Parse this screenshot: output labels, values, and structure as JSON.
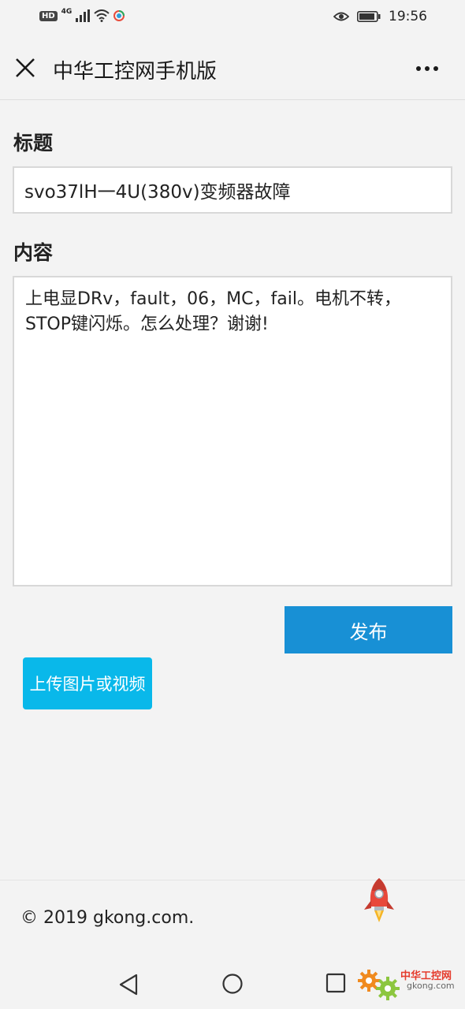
{
  "status_bar": {
    "hd": "HD",
    "network": "4G",
    "time": "19:56"
  },
  "header": {
    "title": "中华工控网手机版"
  },
  "form": {
    "title_label": "标题",
    "title_value": "svo37lH一4U(380v)变频器故障",
    "content_label": "内容",
    "content_value": "上电显DRv，fault，06，MC，fail。电机不转，STOP键闪烁。怎么处理？谢谢!",
    "publish_label": "发布",
    "upload_label": "上传图片或视频"
  },
  "footer": {
    "copyright": "© 2019 gkong.com."
  },
  "watermark": {
    "line1": "中华工控网",
    "line2": "gkong.com"
  },
  "colors": {
    "background": "#f3f3f3",
    "publish_button": "#1890d5",
    "upload_button": "#09b8ea",
    "input_border": "#d8d8d8"
  },
  "icons": [
    "hd-icon",
    "signal-icon",
    "wifi-icon",
    "app-notification-icon",
    "eye-icon",
    "battery-icon",
    "close-icon",
    "more-icon",
    "rocket-icon",
    "nav-back-icon",
    "nav-home-icon",
    "nav-recent-icon",
    "gear-icon"
  ]
}
